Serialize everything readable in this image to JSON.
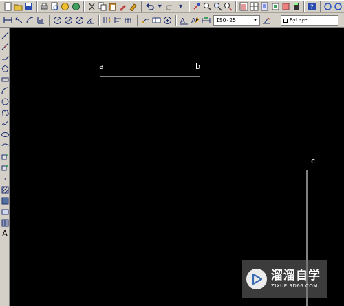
{
  "toolbar": {
    "dim_style": "ISO-25",
    "layer": "ByLayer"
  },
  "left_toolbar": {
    "text_tool": "A"
  },
  "drawing": {
    "point_a": "a",
    "point_b": "b",
    "point_c": "c"
  },
  "watermark": {
    "name": "溜溜自学",
    "url": "ZIXUE.3D66.COM"
  },
  "colors": {
    "canvas": "#000000",
    "line": "#ffffff",
    "toolbar": "#d4d0c8"
  }
}
